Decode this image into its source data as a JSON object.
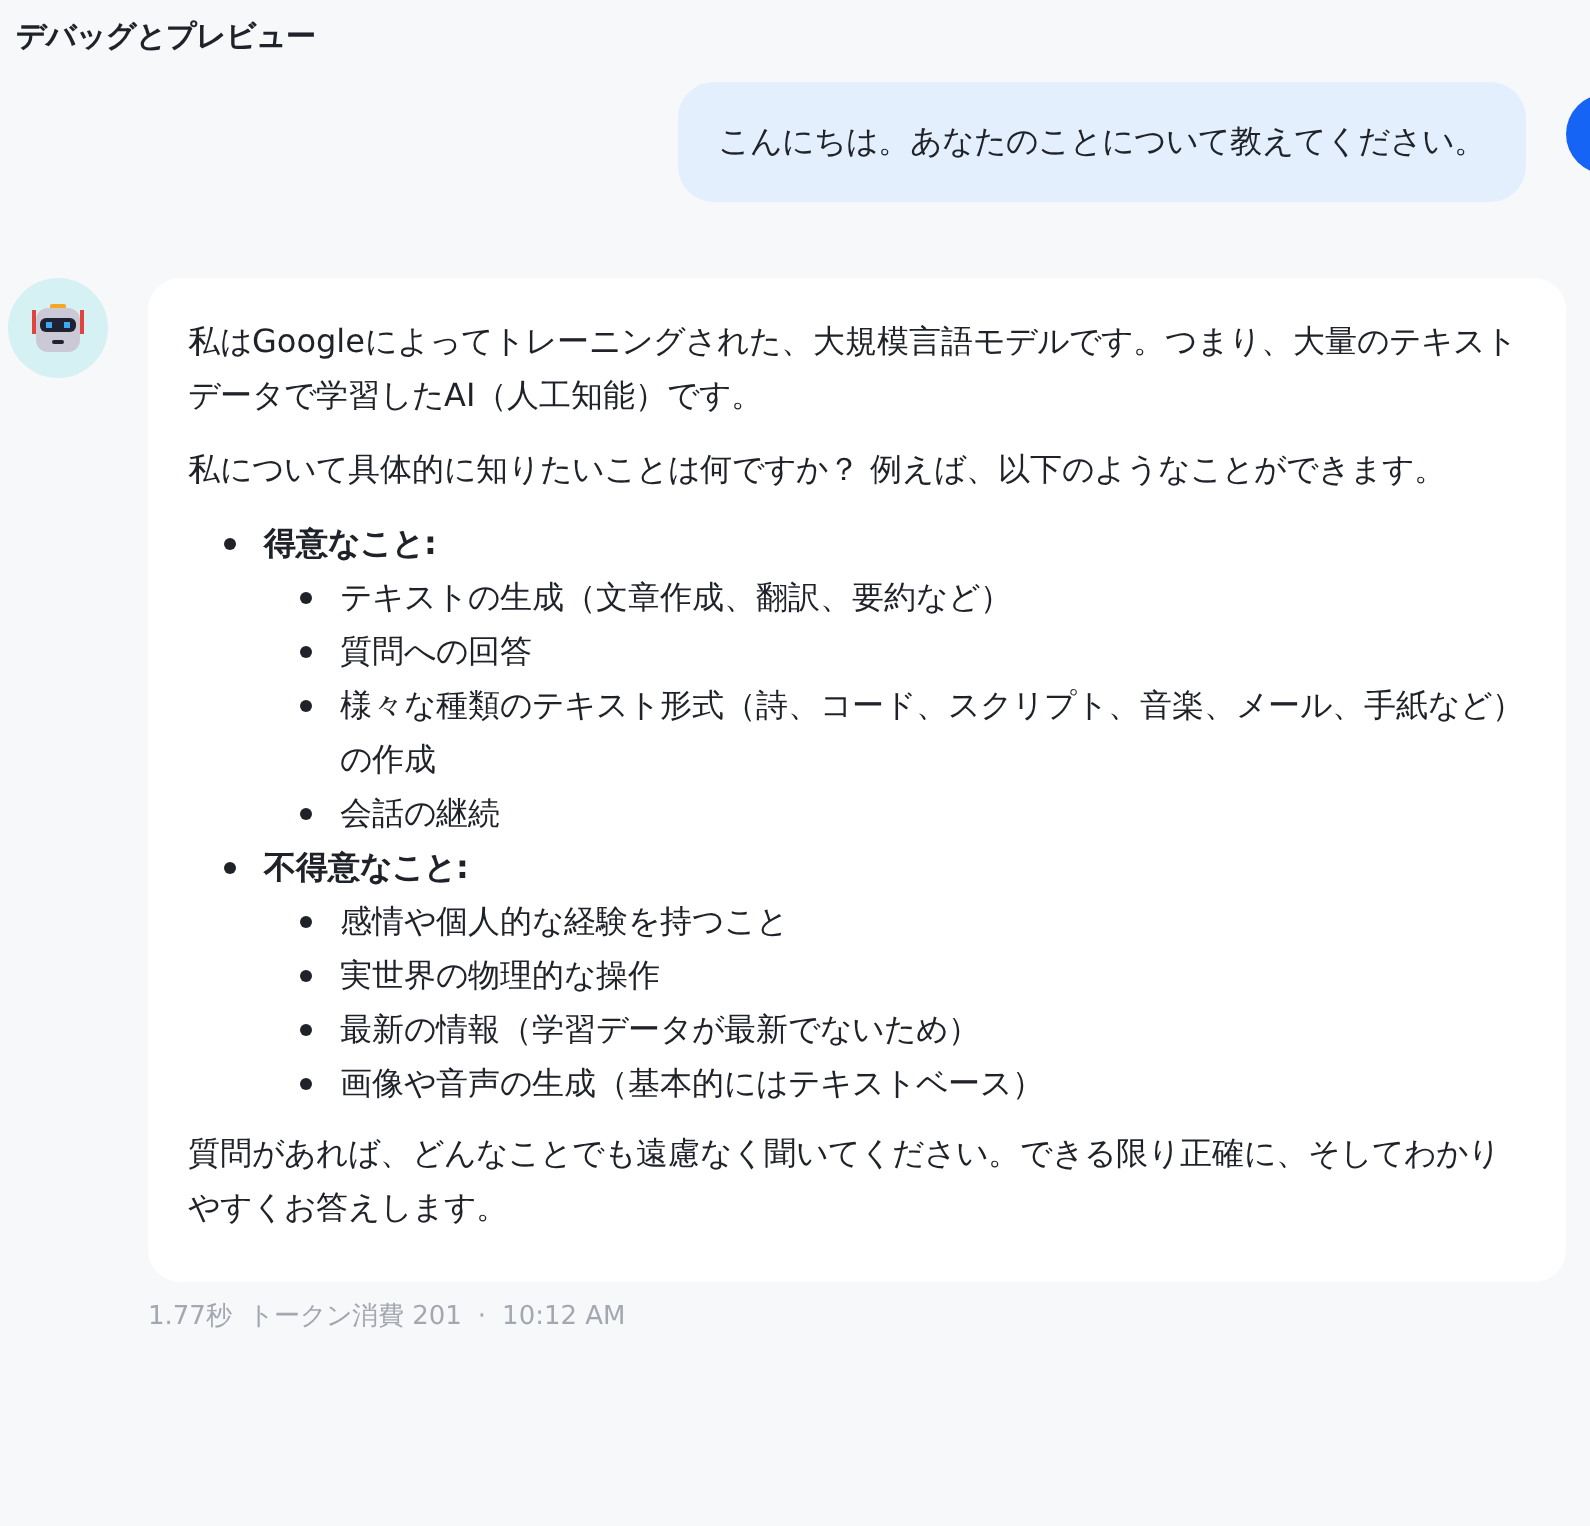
{
  "header": {
    "title": "デバッグとプレビュー"
  },
  "user_message": {
    "text": "こんにちは。あなたのことについて教えてください。"
  },
  "bot_message": {
    "blocks": [
      {
        "kind": "paragraph",
        "text": "私はGoogleによってトレーニングされた、大規模言語モデルです。つまり、大量のテキストデータで学習したAI（人工知能）です。"
      },
      {
        "kind": "paragraph",
        "text": "私について具体的に知りたいことは何ですか？ 例えば、以下のようなことができます。"
      },
      {
        "kind": "list",
        "items": [
          {
            "text": "得意なこと:",
            "children": [
              {
                "text": "テキストの生成（文章作成、翻訳、要約など）"
              },
              {
                "text": "質問への回答"
              },
              {
                "text": "様々な種類のテキスト形式（詩、コード、スクリプト、音楽、メール、手紙など）の作成"
              },
              {
                "text": "会話の継続"
              }
            ]
          },
          {
            "text": "不得意なこと:",
            "children": [
              {
                "text": "感情や個人的な経験を持つこと"
              },
              {
                "text": "実世界の物理的な操作"
              },
              {
                "text": "最新の情報（学習データが最新でないため）"
              },
              {
                "text": "画像や音声の生成（基本的にはテキストベース）"
              }
            ]
          }
        ]
      },
      {
        "kind": "paragraph",
        "text": "質問があれば、どんなことでも遠慮なく聞いてください。できる限り正確に、そしてわかりやすくお答えします。"
      }
    ]
  },
  "meta": {
    "duration": "1.77秒",
    "tokens": "トークン消費 201",
    "separator": "·",
    "time": "10:12 AM"
  }
}
